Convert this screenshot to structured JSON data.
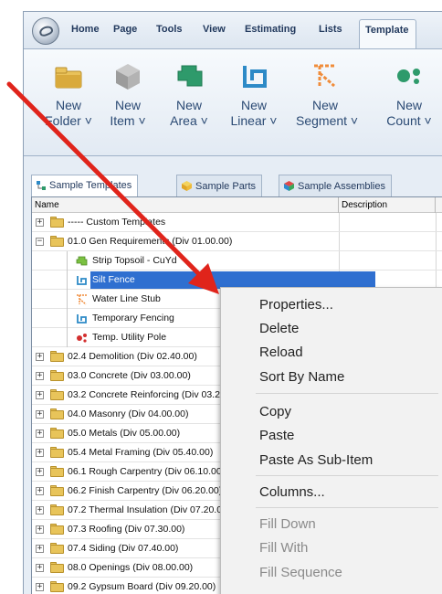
{
  "ribbon": {
    "tabs": [
      "Home",
      "Page",
      "Tools",
      "View",
      "Estimating",
      "Lists",
      "Template"
    ],
    "active_tab": "Template",
    "buttons": [
      {
        "line1": "New",
        "line2": "Folder ˅",
        "icon": "folder-icon",
        "color": "#e9c25a"
      },
      {
        "line1": "New",
        "line2": "Item ˅",
        "icon": "cube-icon",
        "color": "#a9a9a9"
      },
      {
        "line1": "New",
        "line2": "Area ˅",
        "icon": "area-icon",
        "color": "#2e9a6b"
      },
      {
        "line1": "New",
        "line2": "Linear ˅",
        "icon": "linear-icon",
        "color": "#2d8ac7"
      },
      {
        "line1": "New",
        "line2": "Segment ˅",
        "icon": "segment-icon",
        "color": "#f08c3a"
      },
      {
        "line1": "New",
        "line2": "Count ˅",
        "icon": "count-icon",
        "color": "#2e9a6b"
      }
    ]
  },
  "panel_tabs": [
    "Sample Templates",
    "Sample Parts",
    "Sample Assemblies"
  ],
  "columns": [
    "Name",
    "Description"
  ],
  "tree": [
    {
      "label": "----- Custom Templates",
      "kind": "folder",
      "expander": "+",
      "indent": 0
    },
    {
      "label": "01.0 Gen Requirements (Div 01.00.00)",
      "kind": "folder",
      "expander": "−",
      "indent": 0
    },
    {
      "label": "Strip Topsoil - CuYd",
      "kind": "area",
      "indent": 1
    },
    {
      "label": "Silt Fence",
      "kind": "linear",
      "indent": 1,
      "selected": true
    },
    {
      "label": "Water Line Stub",
      "kind": "segment",
      "indent": 1
    },
    {
      "label": "Temporary Fencing",
      "kind": "linear",
      "indent": 1
    },
    {
      "label": "Temp. Utility Pole",
      "kind": "count",
      "indent": 1
    },
    {
      "label": "02.4 Demolition (Div 02.40.00)",
      "kind": "folder",
      "expander": "+",
      "indent": 0
    },
    {
      "label": "03.0 Concrete (Div 03.00.00)",
      "kind": "folder",
      "expander": "+",
      "indent": 0
    },
    {
      "label": "03.2 Concrete Reinforcing (Div 03.20.00)",
      "kind": "folder",
      "expander": "+",
      "indent": 0
    },
    {
      "label": "04.0 Masonry (Div 04.00.00)",
      "kind": "folder",
      "expander": "+",
      "indent": 0
    },
    {
      "label": "05.0 Metals (Div 05.00.00)",
      "kind": "folder",
      "expander": "+",
      "indent": 0
    },
    {
      "label": "05.4 Metal Framing (Div 05.40.00)",
      "kind": "folder",
      "expander": "+",
      "indent": 0
    },
    {
      "label": "06.1 Rough Carpentry (Div 06.10.00)",
      "kind": "folder",
      "expander": "+",
      "indent": 0
    },
    {
      "label": "06.2 Finish Carpentry (Div 06.20.00)",
      "kind": "folder",
      "expander": "+",
      "indent": 0
    },
    {
      "label": "07.2 Thermal Insulation (Div 07.20.00)",
      "kind": "folder",
      "expander": "+",
      "indent": 0
    },
    {
      "label": "07.3 Roofing (Div 07.30.00)",
      "kind": "folder",
      "expander": "+",
      "indent": 0
    },
    {
      "label": "07.4 Siding (Div 07.40.00)",
      "kind": "folder",
      "expander": "+",
      "indent": 0
    },
    {
      "label": "08.0 Openings (Div 08.00.00)",
      "kind": "folder",
      "expander": "+",
      "indent": 0
    },
    {
      "label": "09.2 Gypsum Board (Div 09.20.00)",
      "kind": "folder",
      "expander": "+",
      "indent": 0
    }
  ],
  "context_menu": {
    "items": [
      {
        "label": "Properties...",
        "enabled": true
      },
      {
        "label": "Delete",
        "enabled": true
      },
      {
        "label": "Reload",
        "enabled": true
      },
      {
        "label": "Sort By Name",
        "enabled": true
      },
      {
        "sep": true
      },
      {
        "label": "Copy",
        "enabled": true
      },
      {
        "label": "Paste",
        "enabled": true
      },
      {
        "label": "Paste As Sub-Item",
        "enabled": true
      },
      {
        "sep": true
      },
      {
        "label": "Columns...",
        "enabled": true
      },
      {
        "sep": true
      },
      {
        "label": "Fill Down",
        "enabled": false
      },
      {
        "label": "Fill With",
        "enabled": false
      },
      {
        "label": "Fill Sequence",
        "enabled": false
      }
    ]
  },
  "colors": {
    "selection": "#2f6fd0",
    "arrow": "#e0241b",
    "ribbon_text": "#2b4a74"
  }
}
